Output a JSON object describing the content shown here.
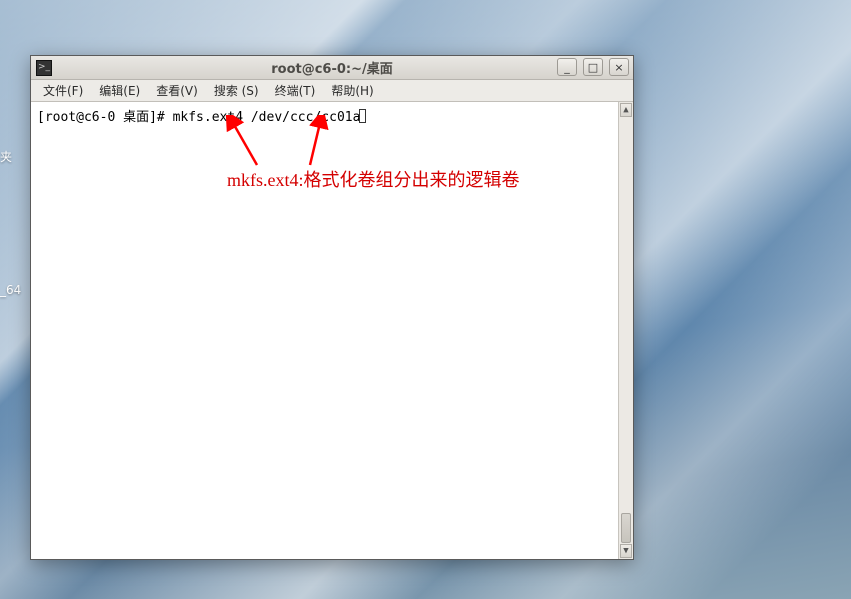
{
  "desktop": {
    "label1": "夹",
    "label2": "_64"
  },
  "window": {
    "title": "root@c6-0:~/桌面",
    "icon_glyph": ">_"
  },
  "menu": {
    "file": "文件(F)",
    "edit": "编辑(E)",
    "view": "查看(V)",
    "search": "搜索 (S)",
    "terminal": "终端(T)",
    "help": "帮助(H)"
  },
  "win_controls": {
    "minimize": "_",
    "maximize": "□",
    "close": "×"
  },
  "terminal": {
    "prompt": "[root@c6-0 桌面]# ",
    "command": "mkfs.ext4 /dev/ccc/cc01a"
  },
  "annotation": {
    "text": "mkfs.ext4:格式化卷组分出来的逻辑卷",
    "arrow_color": "#ff0000"
  }
}
